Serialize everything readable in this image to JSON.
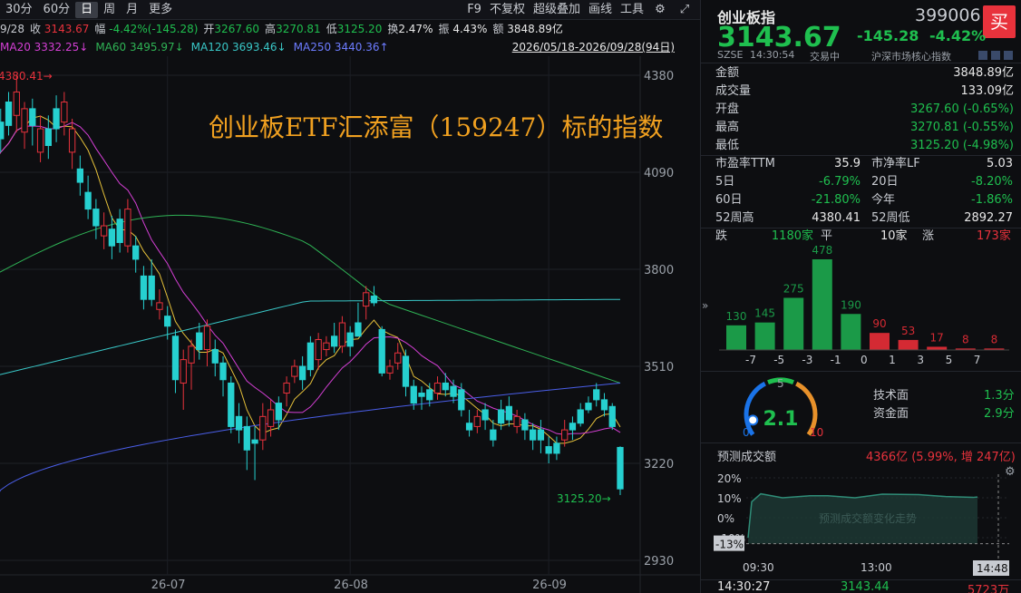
{
  "toolbar": {
    "periods": [
      "30分",
      "60分",
      "日",
      "周",
      "月",
      "更多"
    ],
    "active_period": "日",
    "tools": [
      "F9",
      "不复权",
      "超级叠加",
      "画线",
      "工具"
    ]
  },
  "info": {
    "date": "9/28",
    "close_label": "收",
    "close": "3143.67",
    "change_label": "幅",
    "change": "-4.42%(-145.28)",
    "open_label": "开",
    "open": "3267.60",
    "high_label": "高",
    "high": "3270.81",
    "low_label": "低",
    "low": "3125.20",
    "turnover_label": "换",
    "turnover": "2.47%",
    "amp_label": "振",
    "amp": "4.43%",
    "amount_label": "额",
    "amount": "3848.89亿"
  },
  "ma": {
    "ma20": "MA20 3332.25↓",
    "ma60": "MA60 3495.97↓",
    "ma120": "MA120 3693.46↓",
    "ma250": "MA250 3440.36↑",
    "range": "2026/05/18-2026/09/28(94日)",
    "colors": {
      "ma5": "#e6e6e6",
      "ma10": "#e6c13a",
      "ma20": "#d43fd4",
      "ma60": "#2fb355",
      "ma120": "#39c7c7",
      "ma250": "#4a5ee8"
    }
  },
  "chart_data": {
    "type": "candlestick",
    "title": "创业板ETF汇添富（159247）标的指数",
    "yticks": [
      "4380",
      "4090",
      "3800",
      "3510",
      "3220",
      "2930"
    ],
    "ylim": [
      2930,
      4380
    ],
    "xticks": [
      "26-07",
      "26-08",
      "26-09"
    ],
    "high_marker": "4380.41",
    "low_marker": "3125.20",
    "candles": [
      [
        4160,
        4110,
        4190,
        4060
      ],
      [
        4240,
        4190,
        4280,
        4150
      ],
      [
        4300,
        4230,
        4330,
        4200
      ],
      [
        4260,
        4330,
        4380,
        4210
      ],
      [
        4210,
        4280,
        4300,
        4160
      ],
      [
        4280,
        4230,
        4310,
        4170
      ],
      [
        4150,
        4220,
        4260,
        4120
      ],
      [
        4220,
        4170,
        4260,
        4130
      ],
      [
        4280,
        4220,
        4320,
        4180
      ],
      [
        4240,
        4300,
        4330,
        4200
      ],
      [
        4150,
        4220,
        4250,
        4100
      ],
      [
        4100,
        4060,
        4140,
        4020
      ],
      [
        4030,
        3980,
        4080,
        3950
      ],
      [
        3980,
        3930,
        4010,
        3890
      ],
      [
        3900,
        3930,
        3970,
        3860
      ],
      [
        3920,
        3870,
        3960,
        3830
      ],
      [
        3950,
        3880,
        3980,
        3850
      ],
      [
        3870,
        3980,
        4010,
        3850
      ],
      [
        3870,
        3830,
        3900,
        3790
      ],
      [
        3780,
        3710,
        3810,
        3680
      ],
      [
        3780,
        3710,
        3830,
        3690
      ],
      [
        3680,
        3700,
        3740,
        3650
      ],
      [
        3660,
        3630,
        3690,
        3590
      ],
      [
        3600,
        3470,
        3620,
        3430
      ],
      [
        3460,
        3530,
        3560,
        3380
      ],
      [
        3520,
        3570,
        3590,
        3440
      ],
      [
        3610,
        3560,
        3640,
        3530
      ],
      [
        3560,
        3630,
        3650,
        3510
      ],
      [
        3560,
        3520,
        3590,
        3480
      ],
      [
        3520,
        3470,
        3540,
        3420
      ],
      [
        3460,
        3330,
        3480,
        3310
      ],
      [
        3360,
        3320,
        3400,
        3280
      ],
      [
        3330,
        3260,
        3360,
        3200
      ],
      [
        3290,
        3280,
        3330,
        3170
      ],
      [
        3290,
        3360,
        3400,
        3260
      ],
      [
        3330,
        3380,
        3410,
        3300
      ],
      [
        3400,
        3350,
        3420,
        3320
      ],
      [
        3430,
        3460,
        3480,
        3390
      ],
      [
        3480,
        3510,
        3530,
        3460
      ],
      [
        3510,
        3470,
        3540,
        3440
      ],
      [
        3580,
        3500,
        3600,
        3480
      ],
      [
        3530,
        3590,
        3610,
        3500
      ],
      [
        3560,
        3580,
        3600,
        3540
      ],
      [
        3600,
        3570,
        3640,
        3550
      ],
      [
        3570,
        3640,
        3660,
        3550
      ],
      [
        3610,
        3570,
        3630,
        3540
      ],
      [
        3640,
        3600,
        3700,
        3600
      ],
      [
        3690,
        3730,
        3750,
        3650
      ],
      [
        3720,
        3700,
        3750,
        3690
      ],
      [
        3620,
        3490,
        3630,
        3480
      ],
      [
        3490,
        3510,
        3530,
        3470
      ],
      [
        3520,
        3550,
        3580,
        3500
      ],
      [
        3540,
        3450,
        3560,
        3420
      ],
      [
        3450,
        3400,
        3470,
        3380
      ],
      [
        3430,
        3420,
        3450,
        3380
      ],
      [
        3440,
        3410,
        3460,
        3390
      ],
      [
        3430,
        3460,
        3480,
        3410
      ],
      [
        3460,
        3440,
        3490,
        3420
      ],
      [
        3450,
        3420,
        3470,
        3400
      ],
      [
        3440,
        3380,
        3460,
        3360
      ],
      [
        3340,
        3320,
        3380,
        3300
      ],
      [
        3330,
        3360,
        3380,
        3310
      ],
      [
        3380,
        3350,
        3400,
        3320
      ],
      [
        3320,
        3290,
        3350,
        3270
      ],
      [
        3380,
        3340,
        3410,
        3320
      ],
      [
        3390,
        3350,
        3420,
        3330
      ],
      [
        3330,
        3360,
        3380,
        3310
      ],
      [
        3350,
        3320,
        3370,
        3290
      ],
      [
        3320,
        3290,
        3340,
        3260
      ],
      [
        3320,
        3290,
        3350,
        3250
      ],
      [
        3270,
        3250,
        3300,
        3220
      ],
      [
        3280,
        3250,
        3300,
        3230
      ],
      [
        3290,
        3320,
        3350,
        3270
      ],
      [
        3340,
        3320,
        3360,
        3290
      ],
      [
        3380,
        3340,
        3400,
        3330
      ],
      [
        3400,
        3380,
        3420,
        3370
      ],
      [
        3440,
        3410,
        3460,
        3390
      ],
      [
        3410,
        3380,
        3430,
        3360
      ],
      [
        3390,
        3330,
        3400,
        3320
      ],
      [
        3267.6,
        3143.67,
        3270.81,
        3125.2
      ]
    ]
  },
  "quote": {
    "name": "创业板指",
    "code": "399006",
    "price": "3143.67",
    "change": "-145.28",
    "change_pct": "-4.42%",
    "market": "SZSE",
    "time": "14:30:54",
    "status": "交易中",
    "index_tag": "沪深市场核心指数",
    "buy_label": "买"
  },
  "stats": [
    {
      "label": "金额",
      "value": "3848.89亿"
    },
    {
      "label": "成交量",
      "value": "133.09亿"
    },
    {
      "label": "开盘",
      "value": "3267.60 (-0.65%)"
    },
    {
      "label": "最高",
      "value": "3270.81 (-0.55%)"
    },
    {
      "label": "最低",
      "value": "3125.20 (-4.98%)"
    }
  ],
  "valuation": [
    {
      "l1": "市盈率TTM",
      "v1": "35.9",
      "l2": "市净率LF",
      "v2": "5.03"
    },
    {
      "l1": "5日",
      "v1": "-6.79%",
      "l2": "20日",
      "v2": "-8.20%"
    },
    {
      "l1": "60日",
      "v1": "-21.80%",
      "l2": "今年",
      "v2": "-1.86%"
    },
    {
      "l1": "52周高",
      "v1": "4380.41",
      "l2": "52周低",
      "v2": "2892.27"
    }
  ],
  "breadth": {
    "down_label": "跌",
    "down": "1180家",
    "flat_label": "平",
    "flat": "10家",
    "up_label": "涨",
    "up": "173家"
  },
  "distribution": {
    "values": [
      130,
      145,
      275,
      478,
      190,
      90,
      53,
      17,
      8,
      8
    ],
    "ticks": [
      "-7",
      "-5",
      "-3",
      "-1",
      "0",
      "1",
      "3",
      "5",
      "7"
    ]
  },
  "gauge": {
    "value": "2.1",
    "min": "0",
    "mid": "5",
    "max": "10",
    "tech_label": "技术面",
    "tech": "1.3分",
    "fund_label": "资金面",
    "fund": "2.9分"
  },
  "forecast": {
    "label": "预测成交额",
    "value": "4366亿 (5.99%, 增 247亿)",
    "yticks": [
      "20%",
      "10%",
      "0%",
      "-10%"
    ],
    "ybadge": "-13%",
    "xticks": [
      "09:30",
      "13:00"
    ],
    "xbadge": "14:48",
    "watermark": "预测成交额变化走势"
  },
  "bottom_tick": {
    "time": "14:30:27",
    "price": "3143.44",
    "volume": "5723万"
  }
}
